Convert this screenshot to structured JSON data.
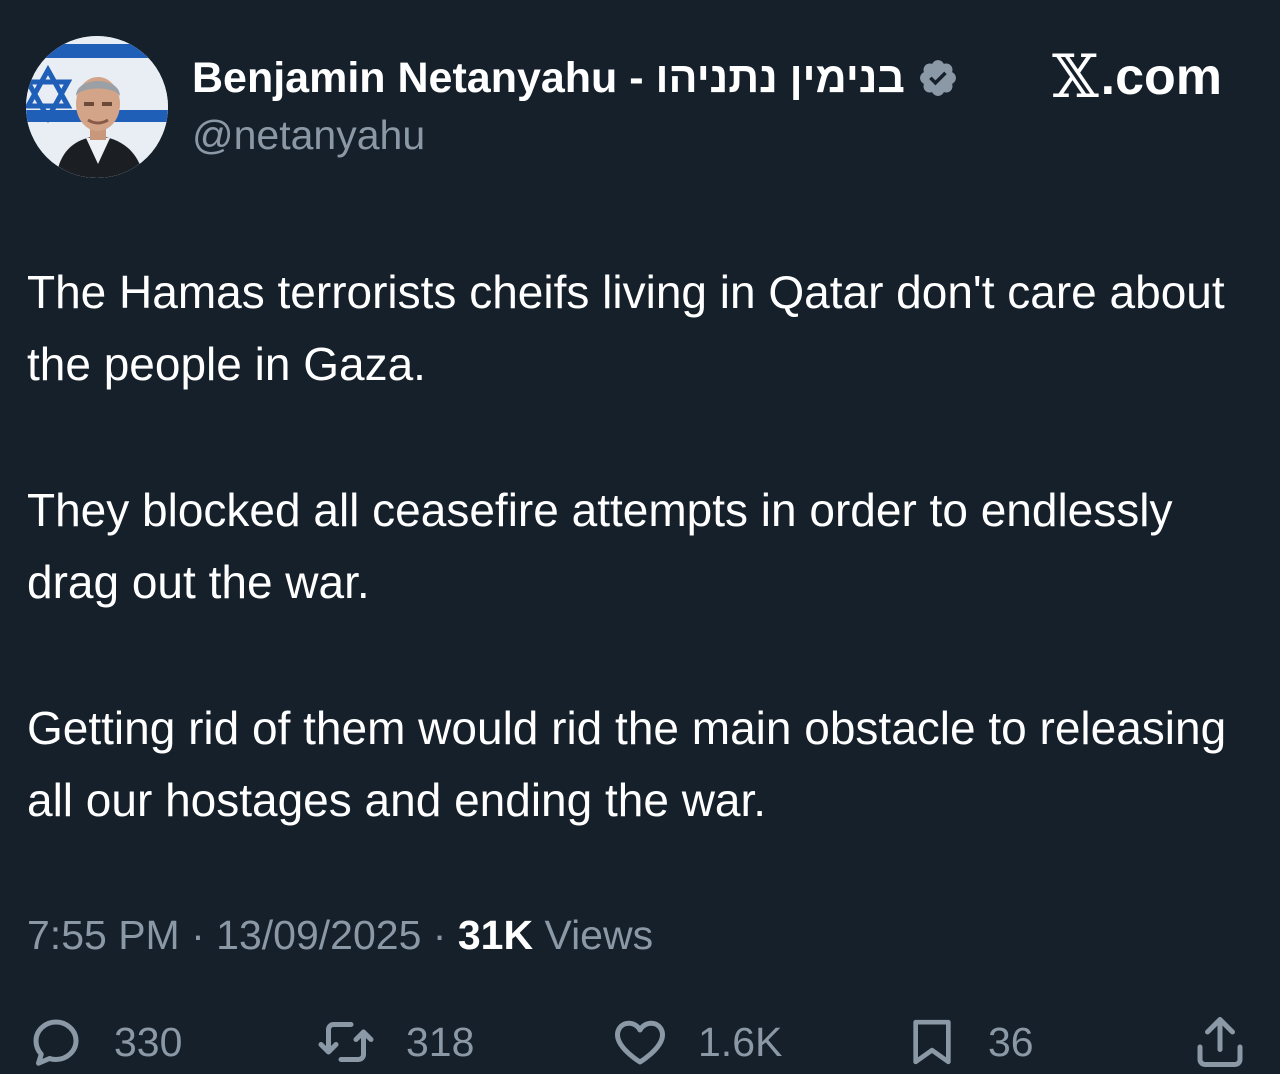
{
  "author": {
    "display_name": "Benjamin Netanyahu - בנימין נתניהו",
    "handle": "@netanyahu",
    "verified_icon": "verified-badge-icon",
    "avatar": "profile-photo"
  },
  "brand": {
    "x_mark": "𝕏",
    "domain": ".com"
  },
  "tweet": {
    "paragraphs": [
      "The Hamas terrorists cheifs living in Qatar don't care about the people in Gaza.",
      "They blocked all ceasefire attempts in order to endlessly drag out the war.",
      "Getting rid of them would rid the main obstacle to releasing all our hostages and ending the war."
    ]
  },
  "meta": {
    "time": "7:55 PM",
    "separator": "·",
    "date": "13/09/2025",
    "views_count": "31K",
    "views_label": "Views"
  },
  "actions": {
    "reply_count": "330",
    "retweet_count": "318",
    "like_count": "1.6K",
    "bookmark_count": "36"
  },
  "colors": {
    "background": "#15202b",
    "text_primary": "#ffffff",
    "text_secondary": "#8b98a5",
    "verified_badge": "#8b98a5"
  }
}
